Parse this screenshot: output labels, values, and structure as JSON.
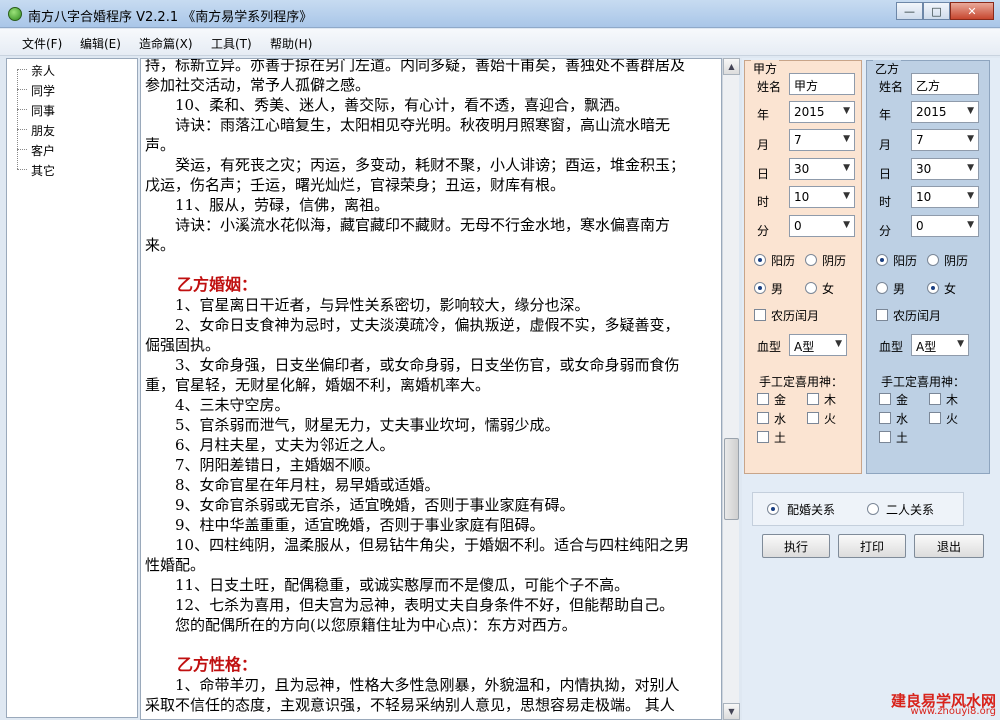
{
  "window": {
    "title": "南方八字合婚程序 V2.2.1  《南方易学系列程序》",
    "minimize": "—",
    "maximize": "□",
    "close": "✕"
  },
  "menu": [
    "文件(F)",
    "编辑(E)",
    "造命篇(X)",
    "工具(T)",
    "帮助(H)"
  ],
  "tree": [
    "亲人",
    "同学",
    "同事",
    "朋友",
    "客户",
    "其它"
  ],
  "content": {
    "lines": [
      {
        "text": "持，标新立异。亦善于掠在另门左道。内同多疑，善始十甫矣，善独处不善群居及",
        "type": "normal"
      },
      {
        "text": "参加社交活动，常予人孤僻之感。",
        "type": "normal"
      },
      {
        "text": "　　10、柔和、秀美、迷人，善交际，有心计，看不透，喜迎合，飘洒。",
        "type": "normal"
      },
      {
        "text": "　　诗诀：雨落江心暗复生，太阳相见夺光明。秋夜明月照寒窗，高山流水暗无",
        "type": "normal"
      },
      {
        "text": "声。",
        "type": "normal"
      },
      {
        "text": "　　癸运，有死丧之灾；丙运，多变动，耗财不聚，小人诽谤；酉运，堆金积玉；",
        "type": "normal"
      },
      {
        "text": "戊运，伤名声；壬运，曙光灿烂，官禄荣身；丑运，财库有根。",
        "type": "normal"
      },
      {
        "text": "　　11、服从，劳碌，信佛，离祖。",
        "type": "normal"
      },
      {
        "text": "　　诗诀：小溪流水花似海，藏官藏印不藏财。无母不行金水地，寒水偏喜南方",
        "type": "normal"
      },
      {
        "text": "来。",
        "type": "normal"
      },
      {
        "text": "",
        "type": "normal"
      },
      {
        "text": "　　乙方婚姻：",
        "type": "heading"
      },
      {
        "text": "　　1、官星离日干近者，与异性关系密切，影响较大，缘分也深。",
        "type": "normal"
      },
      {
        "text": "　　2、女命日支食神为忌时，丈夫淡漠疏冷，偏执叛逆，虚假不实，多疑善变，",
        "type": "normal"
      },
      {
        "text": "倔强固执。",
        "type": "normal"
      },
      {
        "text": "　　3、女命身强，日支坐偏印者，或女命身弱，日支坐伤官，或女命身弱而食伤",
        "type": "normal"
      },
      {
        "text": "重，官星轻，无财星化解，婚姻不利，离婚机率大。",
        "type": "normal"
      },
      {
        "text": "　　4、三未守空房。",
        "type": "normal"
      },
      {
        "text": "　　5、官杀弱而泄气，财星无力，丈夫事业坎坷，懦弱少成。",
        "type": "normal"
      },
      {
        "text": "　　6、月柱夫星，丈夫为邻近之人。",
        "type": "normal"
      },
      {
        "text": "　　7、阴阳差错日，主婚姻不顺。",
        "type": "normal"
      },
      {
        "text": "　　8、女命官星在年月柱，易早婚或适婚。",
        "type": "normal"
      },
      {
        "text": "　　9、女命官杀弱或无官杀，适宜晚婚，否则于事业家庭有碍。",
        "type": "normal"
      },
      {
        "text": "　　9、柱中华盖重重，适宜晚婚，否则于事业家庭有阻碍。",
        "type": "normal"
      },
      {
        "text": "　　10、四柱纯阴，温柔服从，但易钻牛角尖，于婚姻不利。适合与四柱纯阳之男",
        "type": "normal"
      },
      {
        "text": "性婚配。",
        "type": "normal"
      },
      {
        "text": "　　11、日支土旺，配偶稳重，或诚实憨厚而不是傻瓜，可能个子不高。",
        "type": "normal"
      },
      {
        "text": "　　12、七杀为喜用，但夫宫为忌神，表明丈夫自身条件不好，但能帮助自己。",
        "type": "normal"
      },
      {
        "text": "　　您的配偶所在的方向(以您原籍住址为中心点)：东方对西方。",
        "type": "normal"
      },
      {
        "text": "",
        "type": "normal"
      },
      {
        "text": "　　乙方性格：",
        "type": "heading"
      },
      {
        "text": "　　1、命带羊刃，且为忌神，性格大多性急刚暴，外貌温和，内情执拗，对别人",
        "type": "normal"
      },
      {
        "text": "采取不信任的态度，主观意识强，不轻易采纳别人意见，思想容易走极端。 其人",
        "type": "normal"
      }
    ]
  },
  "party_a": {
    "title": "甲方",
    "name_label": "姓名",
    "name_value": "甲方",
    "year_label": "年",
    "year_value": "2015",
    "month_label": "月",
    "month_value": "7",
    "day_label": "日",
    "day_value": "30",
    "hour_label": "时",
    "hour_value": "10",
    "minute_label": "分",
    "minute_value": "0",
    "solar_label": "阳历",
    "lunar_label": "阴历",
    "male_label": "男",
    "female_label": "女",
    "leap_label": "农历闰月",
    "blood_label": "血型",
    "blood_value": "A型",
    "manual_label": "手工定喜用神：",
    "elements": [
      "金",
      "木",
      "水",
      "火",
      "土"
    ]
  },
  "party_b": {
    "title": "乙方",
    "name_label": "姓名",
    "name_value": "乙方",
    "year_label": "年",
    "year_value": "2015",
    "month_label": "月",
    "month_value": "7",
    "day_label": "日",
    "day_value": "30",
    "hour_label": "时",
    "hour_value": "10",
    "minute_label": "分",
    "minute_value": "0",
    "solar_label": "阳历",
    "lunar_label": "阴历",
    "male_label": "男",
    "female_label": "女",
    "leap_label": "农历闰月",
    "blood_label": "血型",
    "blood_value": "A型",
    "manual_label": "手工定喜用神：",
    "elements": [
      "金",
      "木",
      "水",
      "火",
      "土"
    ]
  },
  "relation": {
    "marriage_label": "配婚关系",
    "pair_label": "二人关系"
  },
  "buttons": {
    "execute": "执行",
    "print": "打印",
    "exit": "退出"
  },
  "watermark": {
    "line1": "建良易学风水网",
    "line2": "www.zhouyi8.org"
  }
}
